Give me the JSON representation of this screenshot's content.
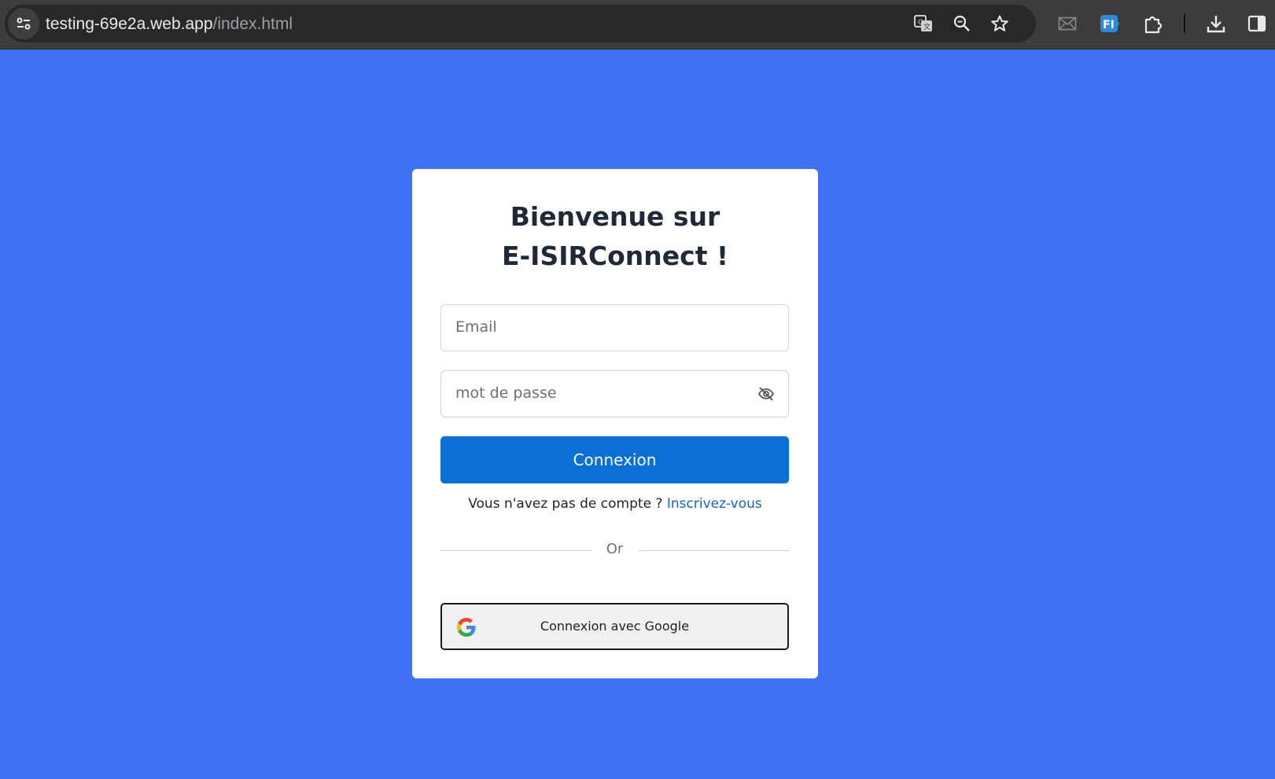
{
  "browser": {
    "url_host": "testing-69e2a.web.app",
    "url_path": "/index.html",
    "toolbar_icons": [
      "site-info-icon",
      "translate-icon",
      "zoom-icon",
      "bookmark-star-icon",
      "mail-icon",
      "fi-extension-icon",
      "extensions-puzzle-icon",
      "download-icon",
      "side-panel-icon"
    ],
    "fi_extension_label": "FI"
  },
  "page": {
    "background_color": "#4171f3",
    "login": {
      "title_line1": "Bienvenue sur",
      "title_line2": "E-ISIRConnect !",
      "email_placeholder": "Email",
      "password_placeholder": "mot de passe",
      "submit_label": "Connexion",
      "signup_prompt": "Vous n'avez pas de compte ?",
      "signup_link": "Inscrivez-vous",
      "divider_text": "Or",
      "google_button_label": "Connexion avec Google",
      "primary_color": "#0b6fd4",
      "link_color": "#1565c0"
    }
  }
}
